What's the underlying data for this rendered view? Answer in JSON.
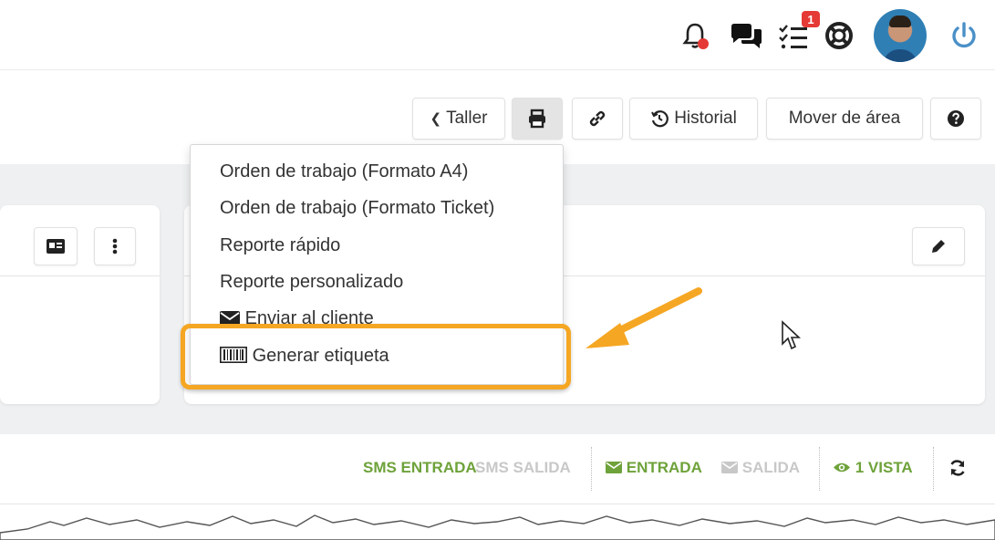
{
  "header": {
    "notifications_badge": "1",
    "icons": [
      "bell-icon",
      "chat-icon",
      "tasks-icon",
      "help-lifebuoy-icon",
      "avatar",
      "power-icon"
    ]
  },
  "toolbar": {
    "taller_label": "Taller",
    "historial_label": "Historial",
    "mover_label": "Mover de área"
  },
  "print_menu": {
    "items": [
      {
        "label": "Orden de trabajo (Formato A4)"
      },
      {
        "label": "Orden de trabajo (Formato Ticket)"
      },
      {
        "label": "Reporte rápido"
      },
      {
        "label": "Reporte personalizado"
      },
      {
        "label": "Enviar al cliente"
      },
      {
        "label": "Generar etiqueta"
      }
    ]
  },
  "message_tabs": {
    "sms_entrada": "SMS ENTRADA",
    "sms_salida": "SMS SALIDA",
    "entrada": "ENTRADA",
    "salida": "SALIDA",
    "vista": "1 VISTA"
  },
  "colors": {
    "accent_green": "#6ea23a",
    "highlight_orange": "#f5a623",
    "badge_red": "#e53935",
    "power_blue": "#4a90c8"
  }
}
